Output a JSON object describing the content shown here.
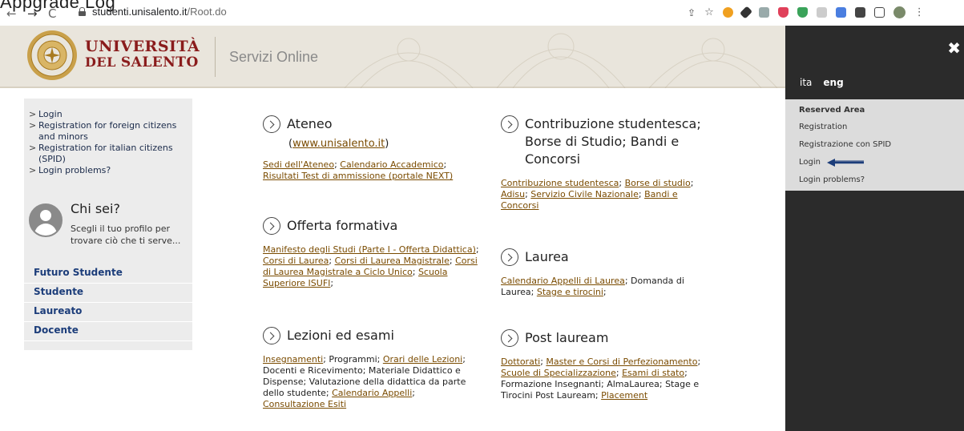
{
  "browser": {
    "top_cut_text": "Appgrade Log",
    "back": "←",
    "forward": "→",
    "reload": "C",
    "url_host": "studenti.unisalento.it",
    "url_path": "/Root.do"
  },
  "header": {
    "logo_line1": "UNIVERSITÀ",
    "logo_line2_small": "DEL ",
    "logo_line2": "SALENTO",
    "service_title": "Servizi Online"
  },
  "left": {
    "links": [
      "Login",
      "Registration for foreign citizens and minors",
      "Registration for italian citizens (SPID)",
      "Login problems?"
    ],
    "chisei_title": "Chi sei?",
    "chisei_text": "Scegli il tuo profilo per trovare ciò che ti serve...",
    "profiles": [
      "Futuro Studente",
      "Studente",
      "Laureato",
      "Docente"
    ]
  },
  "main": {
    "ateneo": {
      "title": "Ateneo",
      "site": "www.unisalento.it",
      "l1": "Sedi dell'Ateneo",
      "sep1": "; ",
      "l2": "Calendario Accademico",
      "sep2": ";",
      "l3": "Risultati Test di ammissione (portale NEXT)"
    },
    "offerta": {
      "title": "Offerta formativa",
      "l1": "Manifesto degli Studi (Parte I - Offerta Didattica)",
      "l2": "Corsi di Laurea",
      "l3": "Corsi di Laurea Magistrale",
      "l4": "Corsi di Laurea Magistrale a Ciclo Unico",
      "l5": "Scuola Superiore ISUFI",
      "sep": "; "
    },
    "lezioni": {
      "title": "Lezioni ed esami",
      "l1": "Insegnamenti",
      "t1": "; Programmi; ",
      "l2": "Orari delle Lezioni",
      "t2": "; Docenti e Ricevimento; Materiale Didattico e Dispense; Valutazione della didattica da parte dello studente; ",
      "l3": "Calendario Appelli",
      "t3": "; ",
      "l4": "Consultazione Esiti"
    },
    "contribuzione": {
      "title": "Contribuzione studentesca; Borse di Studio; Bandi e Concorsi",
      "l1": "Contribuzione studentesca",
      "l2": "Borse di studio",
      "l3": "Adisu",
      "l4": "Servizio Civile Nazionale",
      "l5": "Bandi e Concorsi",
      "sep": "; "
    },
    "laurea": {
      "title": "Laurea",
      "l1": "Calendario Appelli di Laurea",
      "t1": "; Domanda di Laurea; ",
      "l2": "Stage e tirocini",
      "t2": ";"
    },
    "post": {
      "title": "Post lauream",
      "l1": "Dottorati",
      "l2": "Master e Corsi di Perfezionamento",
      "l3": "Scuole di Specializzazione",
      "l4": "Esami di stato",
      "t1": "; Formazione Insegnanti; AlmaLaurea; Stage e Tirocini Post Lauream; ",
      "l5": "Placement",
      "sep": "; "
    }
  },
  "overlay": {
    "close": "✖",
    "lang_ita": "ita",
    "lang_eng": "eng",
    "reserved_title": "Reserved Area",
    "items": [
      "Registration",
      "Registrazione con SPID",
      "Login",
      "Login problems?"
    ]
  },
  "colors": {
    "header_bg": "#e9e5dc",
    "brand_red": "#8a1c1c",
    "link": "#7a4b00",
    "profile_blue": "#1c3d7a",
    "overlay_bg": "#2b2b2b"
  }
}
